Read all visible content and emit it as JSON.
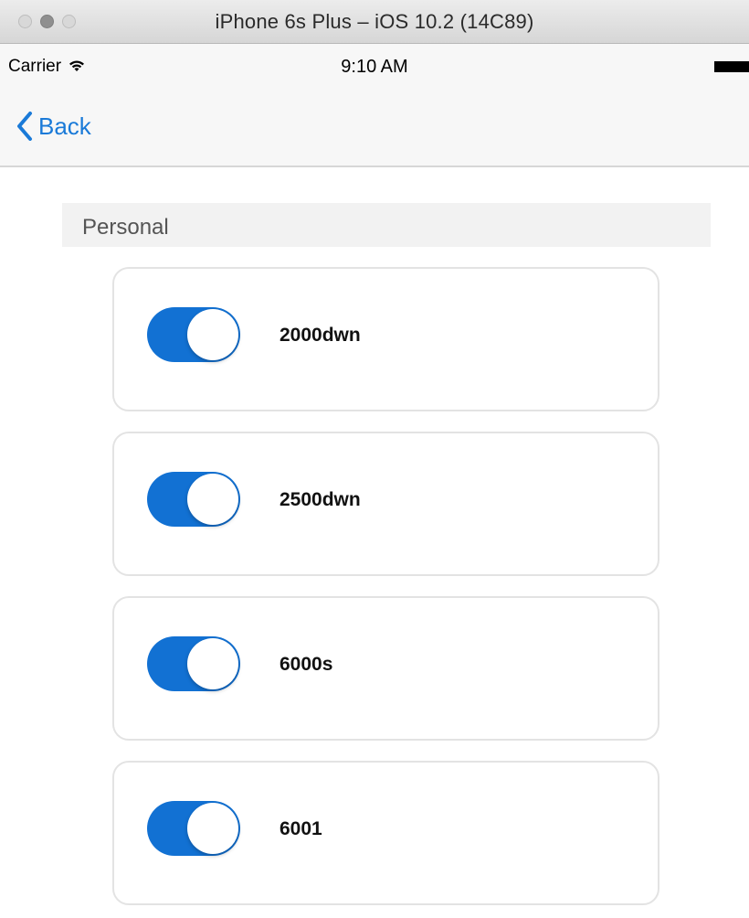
{
  "window": {
    "title": "iPhone 6s Plus – iOS 10.2 (14C89)"
  },
  "status_bar": {
    "carrier": "Carrier",
    "wifi_glyph": "ᯤ",
    "time": "9:10 AM"
  },
  "nav": {
    "back_label": "Back",
    "accent_color": "#1a7ad8"
  },
  "section": {
    "title": "Personal"
  },
  "items": [
    {
      "label": "2000dwn",
      "enabled": true
    },
    {
      "label": "2500dwn",
      "enabled": true
    },
    {
      "label": "6000s",
      "enabled": true
    },
    {
      "label": "6001",
      "enabled": true
    }
  ],
  "toggle_on_color": "#1271d3"
}
